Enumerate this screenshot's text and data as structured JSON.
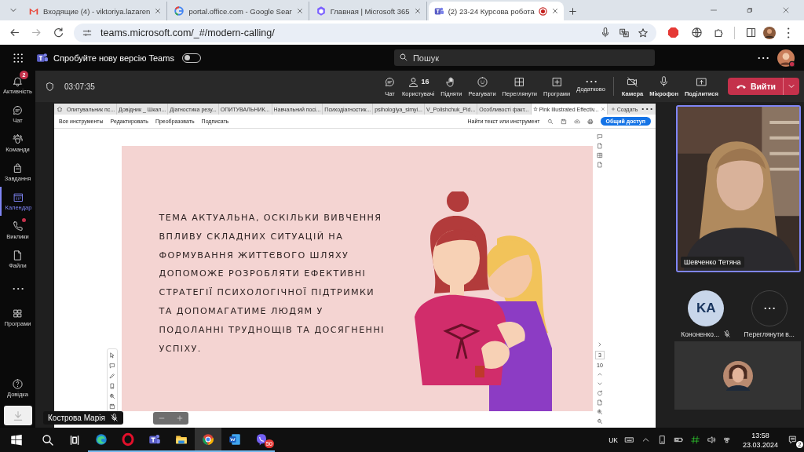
{
  "browser": {
    "tabs": [
      {
        "title": "Входящие (4) - viktoriya.lazaren",
        "selected": false,
        "recording": false
      },
      {
        "title": "portal.office.com - Google Sear",
        "selected": false,
        "recording": false
      },
      {
        "title": "Главная | Microsoft 365",
        "selected": false,
        "recording": false
      },
      {
        "title": "(2) 23-24 Курсова робота",
        "selected": true,
        "recording": true
      }
    ],
    "url": "teams.microsoft.com/_#/modern-calling/"
  },
  "teams_header": {
    "banner": "Спробуйте нову версію Teams",
    "new_teams_on": false,
    "search_placeholder": "Пошук"
  },
  "rail": [
    {
      "label": "Активність",
      "badge": "2",
      "dot": false,
      "selected": false
    },
    {
      "label": "Чат",
      "dot": false,
      "selected": false
    },
    {
      "label": "Команди",
      "dot": false,
      "selected": false
    },
    {
      "label": "Завдання",
      "dot": false,
      "selected": false
    },
    {
      "label": "Календар",
      "dot": false,
      "selected": true
    },
    {
      "label": "Виклики",
      "dot": true,
      "selected": false
    },
    {
      "label": "Файли",
      "dot": false,
      "selected": false
    },
    {
      "dot": false,
      "selected": false
    },
    {
      "label": "Програми",
      "dot": false,
      "selected": false
    }
  ],
  "rail_bottom": {
    "label": "Довідка"
  },
  "meeting_bar": {
    "timer": "03:07:35",
    "actions": [
      {
        "label": "Чат"
      },
      {
        "label": "Користувачі",
        "count": "16"
      },
      {
        "label": "Підняти"
      },
      {
        "label": "Реагувати"
      },
      {
        "label": "Переглянути"
      },
      {
        "label": "Програми"
      },
      {
        "label": "Додатково"
      }
    ],
    "devices": [
      {
        "label": "Камера"
      },
      {
        "label": "Мікрофон"
      },
      {
        "label": "Поділитися"
      }
    ],
    "leave": "Вийти"
  },
  "shared_screen": {
    "tabs": [
      {
        "title": "Опитувальник пс...",
        "selected": false
      },
      {
        "title": "Довідник _ Шкал...",
        "selected": false
      },
      {
        "title": "Діагностика резу...",
        "selected": false
      },
      {
        "title": "ОПИТУВАЛЬНИК...",
        "selected": false
      },
      {
        "title": "Навчальний посі...",
        "selected": false
      },
      {
        "title": "Психодіагностик...",
        "selected": false
      },
      {
        "title": "psihologiya_simyi...",
        "selected": false
      },
      {
        "title": "V_Polishchuk_Pid...",
        "selected": false
      },
      {
        "title": "Особливості факт...",
        "selected": false
      },
      {
        "title": "Pink Illustrated Effectiv...",
        "selected": true
      }
    ],
    "new_tab": "Создать",
    "menu": [
      "Все инструменты",
      "Редактировать",
      "Преобразовать",
      "Подписать"
    ],
    "find": "Найти текст или инструмент",
    "share_button": "Общий доступ",
    "slide_text": "ТЕМА АКТУАЛЬНА, ОСКІЛЬКИ ВИВЧЕННЯ\nВПЛИВУ СКЛАДНИХ СИТУАЦІЙ НА\nФОРМУВАННЯ ЖИТТЄВОГО ШЛЯХУ\nДОПОМОЖЕ РОЗРОБЛЯТИ ЕФЕКТИВНІ\nСТРАТЕГІЇ ПСИХОЛОГІЧНОЇ ПІДТРИМКИ\nТА ДОПОМАГАТИМЕ ЛЮДЯМ У\nПОДОЛАННІ ТРУДНОЩІВ ТА ДОСЯГНЕННІ\nУСПІХУ.",
    "page": "3",
    "pages": "10",
    "presenter": "Кострова Марія"
  },
  "participants": {
    "speaker": "Шевченко Тетяна",
    "others": [
      {
        "initials": "KA",
        "name": "Кононенко...",
        "muted": true
      }
    ],
    "view_more": "Переглянути в..."
  },
  "taskbar": {
    "apps": [
      {
        "active": false
      },
      {
        "active": false
      },
      {
        "active": false
      },
      {
        "active": false
      },
      {
        "active": true
      },
      {
        "active": false
      },
      {
        "active": false,
        "badge": "50"
      }
    ],
    "language": "UK",
    "time": "13:58",
    "date": "23.03.2024",
    "notifications": "2"
  }
}
